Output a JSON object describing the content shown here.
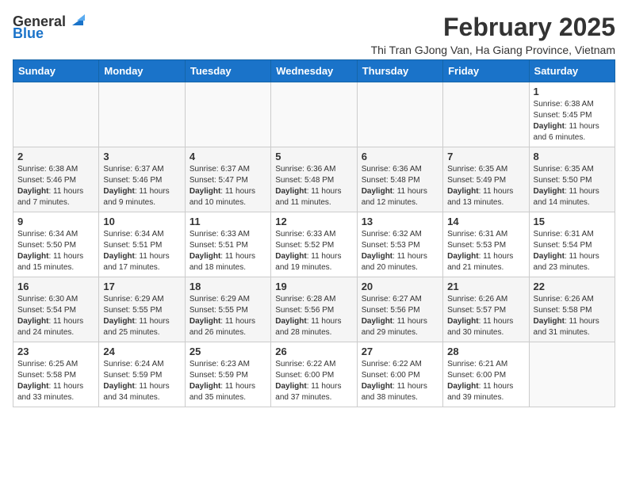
{
  "header": {
    "logo_general": "General",
    "logo_blue": "Blue",
    "month": "February 2025",
    "location": "Thi Tran GJong Van, Ha Giang Province, Vietnam"
  },
  "weekdays": [
    "Sunday",
    "Monday",
    "Tuesday",
    "Wednesday",
    "Thursday",
    "Friday",
    "Saturday"
  ],
  "weeks": [
    [
      {
        "day": "",
        "info": ""
      },
      {
        "day": "",
        "info": ""
      },
      {
        "day": "",
        "info": ""
      },
      {
        "day": "",
        "info": ""
      },
      {
        "day": "",
        "info": ""
      },
      {
        "day": "",
        "info": ""
      },
      {
        "day": "1",
        "info": "Sunrise: 6:38 AM\nSunset: 5:45 PM\nDaylight: 11 hours and 6 minutes."
      }
    ],
    [
      {
        "day": "2",
        "info": "Sunrise: 6:38 AM\nSunset: 5:46 PM\nDaylight: 11 hours and 7 minutes."
      },
      {
        "day": "3",
        "info": "Sunrise: 6:37 AM\nSunset: 5:46 PM\nDaylight: 11 hours and 9 minutes."
      },
      {
        "day": "4",
        "info": "Sunrise: 6:37 AM\nSunset: 5:47 PM\nDaylight: 11 hours and 10 minutes."
      },
      {
        "day": "5",
        "info": "Sunrise: 6:36 AM\nSunset: 5:48 PM\nDaylight: 11 hours and 11 minutes."
      },
      {
        "day": "6",
        "info": "Sunrise: 6:36 AM\nSunset: 5:48 PM\nDaylight: 11 hours and 12 minutes."
      },
      {
        "day": "7",
        "info": "Sunrise: 6:35 AM\nSunset: 5:49 PM\nDaylight: 11 hours and 13 minutes."
      },
      {
        "day": "8",
        "info": "Sunrise: 6:35 AM\nSunset: 5:50 PM\nDaylight: 11 hours and 14 minutes."
      }
    ],
    [
      {
        "day": "9",
        "info": "Sunrise: 6:34 AM\nSunset: 5:50 PM\nDaylight: 11 hours and 15 minutes."
      },
      {
        "day": "10",
        "info": "Sunrise: 6:34 AM\nSunset: 5:51 PM\nDaylight: 11 hours and 17 minutes."
      },
      {
        "day": "11",
        "info": "Sunrise: 6:33 AM\nSunset: 5:51 PM\nDaylight: 11 hours and 18 minutes."
      },
      {
        "day": "12",
        "info": "Sunrise: 6:33 AM\nSunset: 5:52 PM\nDaylight: 11 hours and 19 minutes."
      },
      {
        "day": "13",
        "info": "Sunrise: 6:32 AM\nSunset: 5:53 PM\nDaylight: 11 hours and 20 minutes."
      },
      {
        "day": "14",
        "info": "Sunrise: 6:31 AM\nSunset: 5:53 PM\nDaylight: 11 hours and 21 minutes."
      },
      {
        "day": "15",
        "info": "Sunrise: 6:31 AM\nSunset: 5:54 PM\nDaylight: 11 hours and 23 minutes."
      }
    ],
    [
      {
        "day": "16",
        "info": "Sunrise: 6:30 AM\nSunset: 5:54 PM\nDaylight: 11 hours and 24 minutes."
      },
      {
        "day": "17",
        "info": "Sunrise: 6:29 AM\nSunset: 5:55 PM\nDaylight: 11 hours and 25 minutes."
      },
      {
        "day": "18",
        "info": "Sunrise: 6:29 AM\nSunset: 5:55 PM\nDaylight: 11 hours and 26 minutes."
      },
      {
        "day": "19",
        "info": "Sunrise: 6:28 AM\nSunset: 5:56 PM\nDaylight: 11 hours and 28 minutes."
      },
      {
        "day": "20",
        "info": "Sunrise: 6:27 AM\nSunset: 5:56 PM\nDaylight: 11 hours and 29 minutes."
      },
      {
        "day": "21",
        "info": "Sunrise: 6:26 AM\nSunset: 5:57 PM\nDaylight: 11 hours and 30 minutes."
      },
      {
        "day": "22",
        "info": "Sunrise: 6:26 AM\nSunset: 5:58 PM\nDaylight: 11 hours and 31 minutes."
      }
    ],
    [
      {
        "day": "23",
        "info": "Sunrise: 6:25 AM\nSunset: 5:58 PM\nDaylight: 11 hours and 33 minutes."
      },
      {
        "day": "24",
        "info": "Sunrise: 6:24 AM\nSunset: 5:59 PM\nDaylight: 11 hours and 34 minutes."
      },
      {
        "day": "25",
        "info": "Sunrise: 6:23 AM\nSunset: 5:59 PM\nDaylight: 11 hours and 35 minutes."
      },
      {
        "day": "26",
        "info": "Sunrise: 6:22 AM\nSunset: 6:00 PM\nDaylight: 11 hours and 37 minutes."
      },
      {
        "day": "27",
        "info": "Sunrise: 6:22 AM\nSunset: 6:00 PM\nDaylight: 11 hours and 38 minutes."
      },
      {
        "day": "28",
        "info": "Sunrise: 6:21 AM\nSunset: 6:00 PM\nDaylight: 11 hours and 39 minutes."
      },
      {
        "day": "",
        "info": ""
      }
    ]
  ]
}
